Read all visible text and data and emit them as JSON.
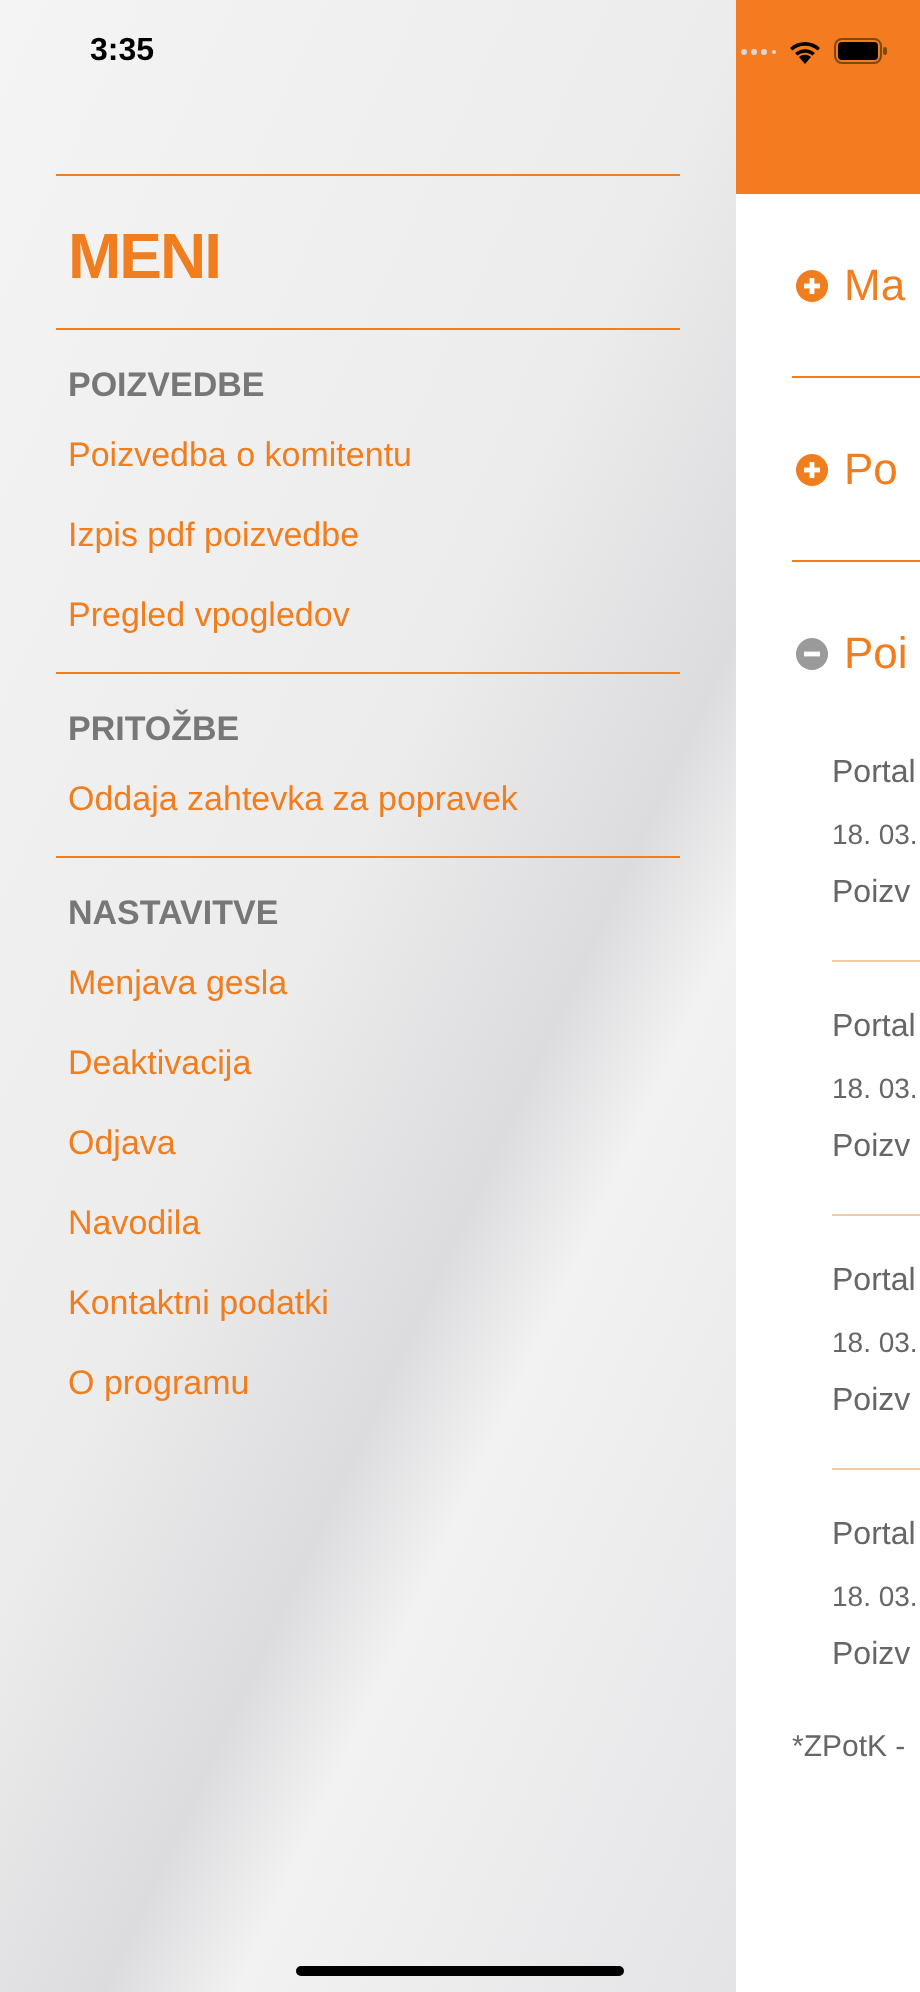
{
  "status_bar": {
    "time": "3:35"
  },
  "menu": {
    "title": "MENI",
    "sections": [
      {
        "heading": "POIZVEDBE",
        "items": [
          "Poizvedba o komitentu",
          "Izpis pdf poizvedbe",
          "Pregled vpogledov"
        ]
      },
      {
        "heading": "PRITOŽBE",
        "items": [
          "Oddaja zahtevka za popravek"
        ]
      },
      {
        "heading": "NASTAVITVE",
        "items": [
          "Menjava gesla",
          "Deaktivacija",
          "Odjava",
          "Navodila",
          "Kontaktni podatki",
          "O programu"
        ]
      }
    ]
  },
  "content": {
    "sections": [
      {
        "title": "Ma",
        "expanded": false
      },
      {
        "title": "Po",
        "expanded": false
      },
      {
        "title": "Poi",
        "expanded": true
      }
    ],
    "entries": [
      {
        "line_1": "Portal",
        "line_2": "18. 03.",
        "line_3": "Poizv"
      },
      {
        "line_1": "Portal",
        "line_2": "18. 03.",
        "line_3": "Poizv"
      },
      {
        "line_1": "Portal",
        "line_2": "18. 03.",
        "line_3": "Poizv"
      },
      {
        "line_1": "Portal",
        "line_2": "18. 03.",
        "line_3": "Poizv"
      }
    ],
    "footnote": "*ZPotK -"
  }
}
